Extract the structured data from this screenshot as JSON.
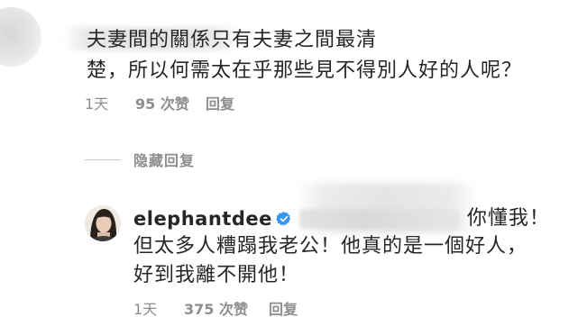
{
  "parent_comment": {
    "text": "夫妻間的關係只有夫妻之間最清\n楚，所以何需太在乎那些見不得別人好的人呢？",
    "time": "1天",
    "likes": "95 次赞",
    "reply_label": "回复"
  },
  "hide_replies_label": "隐藏回复",
  "reply_comment": {
    "username": "elephantdee",
    "first_line": "你懂我！",
    "body": "但太多人糟蹋我老公！他真的是一個好人，\n好到我離不開他！",
    "time": "1天",
    "likes": "375 次赞",
    "reply_label": "回复"
  },
  "colors": {
    "text": "#262626",
    "secondary": "#8e8e8e",
    "verified": "#3897f0"
  },
  "icons": [
    "verified-badge-icon"
  ]
}
